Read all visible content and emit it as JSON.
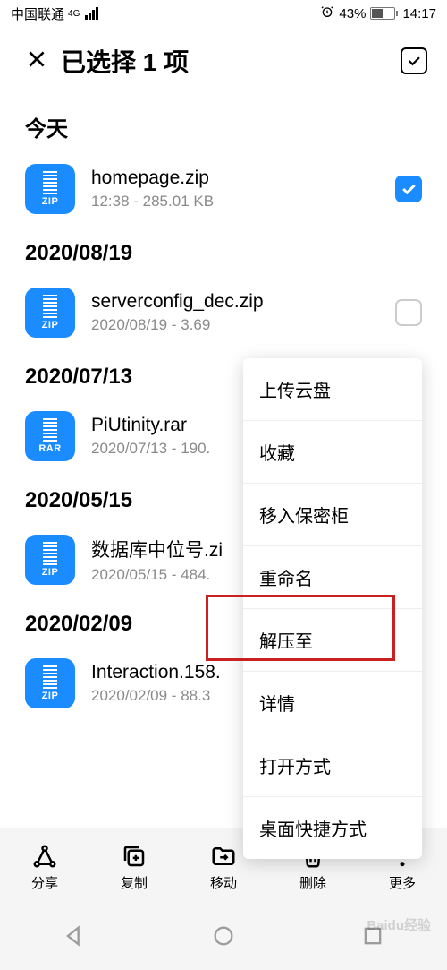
{
  "status": {
    "carrier": "中国联通",
    "network": "4G",
    "battery_pct": "43%",
    "time": "14:17"
  },
  "header": {
    "title": "已选择 1 项"
  },
  "sections": [
    {
      "title": "今天",
      "files": [
        {
          "name": "homepage.zip",
          "meta": "12:38 - 285.01 KB",
          "ext": "ZIP",
          "checked": true
        }
      ]
    },
    {
      "title": "2020/08/19",
      "files": [
        {
          "name": "serverconfig_dec.zip",
          "meta": "2020/08/19 - 3.69",
          "ext": "ZIP",
          "checked": false
        }
      ]
    },
    {
      "title": "2020/07/13",
      "files": [
        {
          "name": "PiUtinity.rar",
          "meta": "2020/07/13 - 190.",
          "ext": "RAR",
          "checked": false
        }
      ]
    },
    {
      "title": "2020/05/15",
      "files": [
        {
          "name": "数据库中位号.zi",
          "meta": "2020/05/15 - 484.",
          "ext": "ZIP",
          "checked": false
        }
      ]
    },
    {
      "title": "2020/02/09",
      "files": [
        {
          "name": "Interaction.158.",
          "meta": "2020/02/09 - 88.3",
          "ext": "ZIP",
          "checked": false
        }
      ]
    }
  ],
  "context_menu": {
    "items": [
      "上传云盘",
      "收藏",
      "移入保密柜",
      "重命名",
      "解压至",
      "详情",
      "打开方式",
      "桌面快捷方式"
    ]
  },
  "toolbar": {
    "share": "分享",
    "copy": "复制",
    "move": "移动",
    "delete": "删除",
    "more": "更多"
  },
  "watermark": "Baidu经验"
}
